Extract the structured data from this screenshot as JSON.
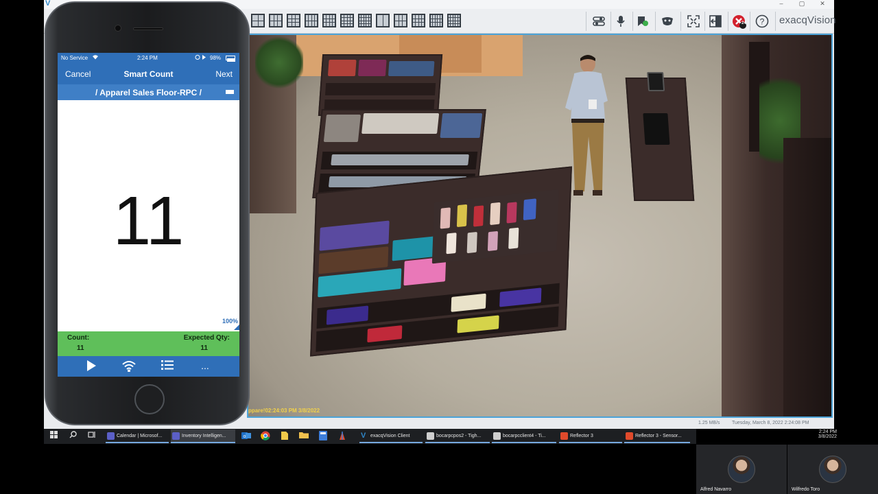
{
  "exacq": {
    "window_controls": [
      "–",
      "▢",
      "✕"
    ],
    "logo": "exacqVision",
    "toolbar_icons": [
      "sliders-icon",
      "microphone-icon",
      "bookmark-icon",
      "face-icon",
      "fullscreen-icon",
      "exit-icon",
      "alarm-icon",
      "help-icon"
    ],
    "alarm_badge": "24",
    "camera_timestamp": "ppare!02:24:03 PM 3/8/2022",
    "status": {
      "bandwidth": "1.25 MB/s",
      "datetime": "Tuesday, March 8, 2022    2:24:08 PM"
    }
  },
  "phone": {
    "status": {
      "carrier": "No Service",
      "time": "2:24 PM",
      "battery": "98%"
    },
    "nav": {
      "cancel": "Cancel",
      "title": "Smart Count",
      "next": "Next"
    },
    "location": "/  Apparel Sales Floor-RPC  /",
    "count_display": "11",
    "progress": "100%",
    "count_label": "Count:",
    "count_value": "11",
    "expected_label": "Expected Qty:",
    "expected_value": "11",
    "bottom_icons": [
      "play-icon",
      "wifi-icon",
      "list-icon",
      "more-icon"
    ],
    "more_glyph": "..."
  },
  "taskbar": {
    "apps": [
      {
        "label": "Calendar | Microsof...",
        "color": "#5b5fc7"
      },
      {
        "label": "Inventory Intelligen...",
        "color": "#5b5fc7"
      },
      {
        "label": "exacqVision Client",
        "color": "#2f87c9"
      },
      {
        "label": "bocarpcpos2 - Tigh...",
        "color": "#cfcfcf"
      },
      {
        "label": "bocarpcclient4 - Ti...",
        "color": "#cfcfcf"
      },
      {
        "label": "Reflector 3",
        "color": "#e04a2b"
      },
      {
        "label": "Reflector 3 - Sensor...",
        "color": "#e04a2b"
      }
    ],
    "clock_time": "2:24 PM",
    "clock_date": "3/8/2022"
  },
  "participants": [
    {
      "name": "Alfred Navarro"
    },
    {
      "name": "Wilfredo Toro"
    }
  ]
}
